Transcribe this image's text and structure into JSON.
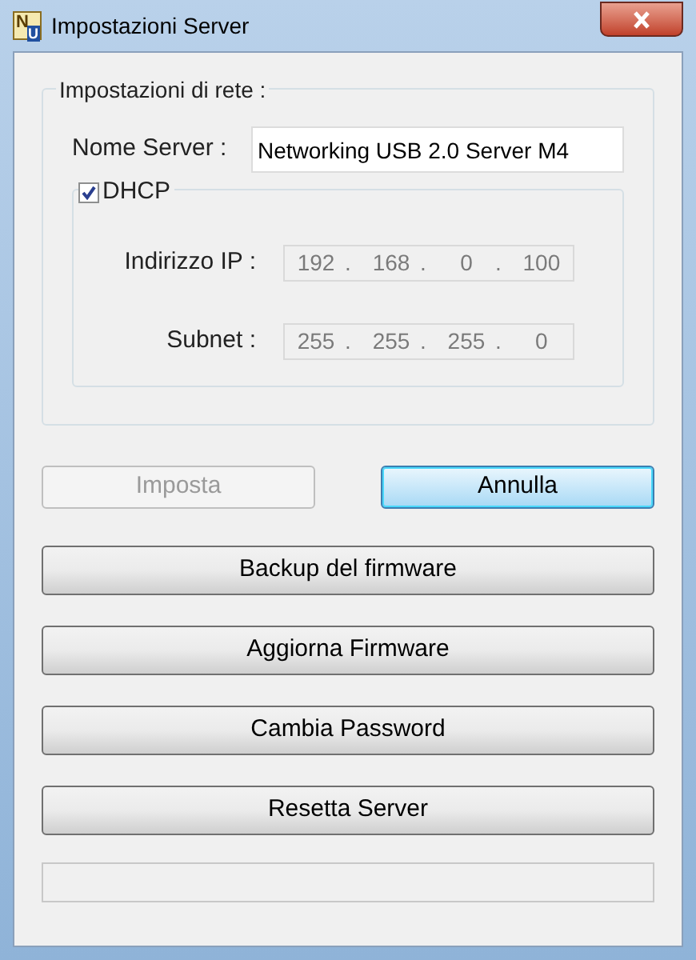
{
  "window": {
    "title": "Impostazioni Server",
    "icon_letters": [
      "N",
      "U"
    ]
  },
  "network_group": {
    "title": "Impostazioni di rete :",
    "server_name": {
      "label": "Nome Server :",
      "value": "Networking USB 2.0 Server M4"
    },
    "dhcp": {
      "label": "DHCP",
      "checked": true
    },
    "ip_fields": [
      {
        "label": "Indirizzo IP :",
        "octets": [
          "192",
          "168",
          "0",
          "100"
        ],
        "separator": ".",
        "disabled": true
      },
      {
        "label": "Subnet :",
        "octets": [
          "255",
          "255",
          "255",
          "0"
        ],
        "separator": ".",
        "disabled": true
      }
    ]
  },
  "action_buttons": [
    {
      "label": "Imposta",
      "disabled": true,
      "focused": false
    },
    {
      "label": "Annulla",
      "disabled": false,
      "focused": true
    }
  ],
  "buttons": [
    "Backup del firmware",
    "Aggiorna Firmware",
    "Cambia Password",
    "Resetta Server"
  ]
}
